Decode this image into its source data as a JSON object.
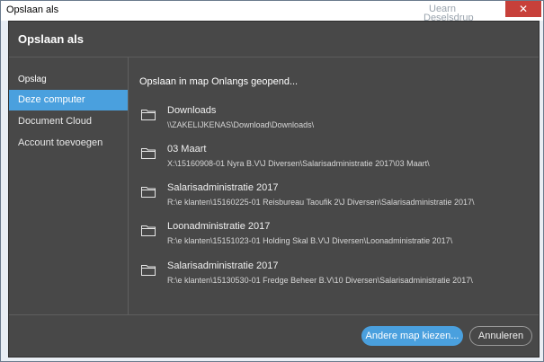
{
  "window": {
    "title": "Opslaan als",
    "bg_text_1": "Uearn",
    "bg_text_2": "Deselsdrup"
  },
  "dialog": {
    "title": "Opslaan als"
  },
  "sidebar": {
    "section_label": "Opslag",
    "items": [
      {
        "label": "Deze computer",
        "active": true
      },
      {
        "label": "Document Cloud",
        "active": false
      },
      {
        "label": "Account toevoegen",
        "active": false
      }
    ]
  },
  "main": {
    "heading": "Opslaan in map Onlangs geopend...",
    "folders": [
      {
        "name": "Downloads",
        "path": "\\\\ZAKELIJKENAS\\Download\\Downloads\\"
      },
      {
        "name": "03 Maart",
        "path": "X:\\15160908-01 Nyra B.V\\J Diversen\\Salarisadministratie 2017\\03 Maart\\"
      },
      {
        "name": "Salarisadministratie 2017",
        "path": "R:\\e klanten\\15160225-01 Reisbureau Taoufik 2\\J Diversen\\Salarisadministratie 2017\\"
      },
      {
        "name": "Loonadministratie 2017",
        "path": "R:\\e klanten\\15151023-01 Holding Skal B.V\\J Diversen\\Loonadministratie 2017\\"
      },
      {
        "name": "Salarisadministratie 2017",
        "path": "R:\\e klanten\\15130530-01 Fredge Beheer B.V\\10 Diversen\\Salarisadministratie 2017\\"
      }
    ]
  },
  "footer": {
    "choose_label": "Andere map kiezen...",
    "cancel_label": "Annuleren"
  },
  "icons": {
    "close": "close-icon",
    "folder": "folder-icon"
  },
  "colors": {
    "accent": "#4aa0de",
    "dialog_bg": "#484848",
    "close_red": "#c7403a"
  }
}
